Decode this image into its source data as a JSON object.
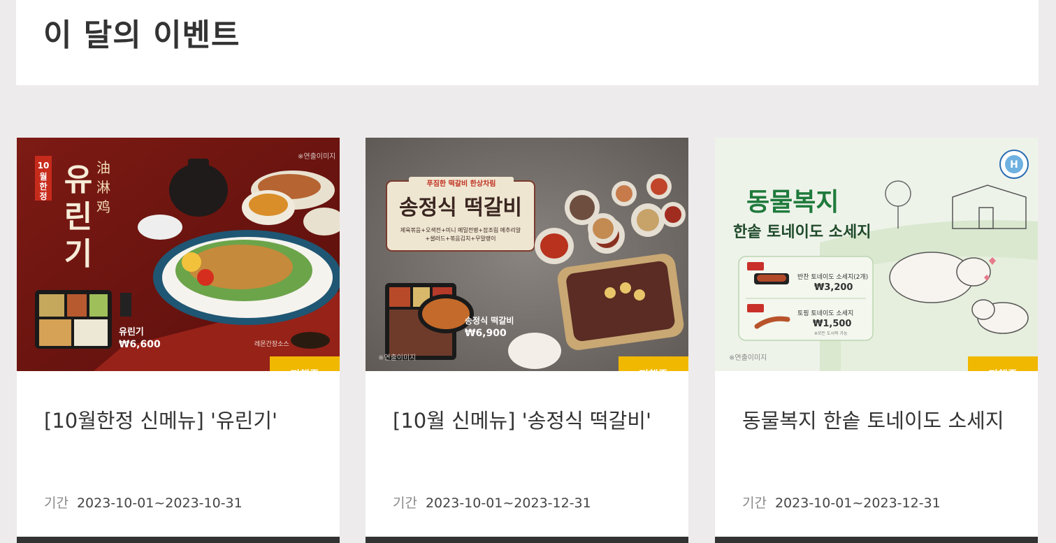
{
  "page": {
    "title": "이 달의 이벤트"
  },
  "cards": [
    {
      "title": "[10월한정 신메뉴] '유린기'",
      "period_label": "기간",
      "period": "2023-10-01~2023-10-31",
      "badge": "진행중",
      "image": {
        "vertical_label": "10월한정",
        "big_text": "유린기",
        "hanzi": "油淋鸡",
        "watermark": "※연출이미지",
        "product_name": "유린기",
        "price": "₩6,600",
        "sauce_label": "레몬간장소스"
      }
    },
    {
      "title": "[10월 신메뉴] '송정식 떡갈비'",
      "period_label": "기간",
      "period": "2023-10-01~2023-12-31",
      "badge": "진행중",
      "image": {
        "ribbon": "푸짐한 떡갈비 한상차림",
        "big_text": "송정식 떡갈비",
        "menu_line1": "제육볶음+오색전+미니 메밀전병+잡조림 메추리알",
        "menu_line2": "+샐러드+볶음김치+무말랭이",
        "product_name": "송정식 떡갈비",
        "price": "₩6,900",
        "watermark": "※연출이미지"
      }
    },
    {
      "title": "동물복지 한솥 토네이도 소세지",
      "period_label": "기간",
      "period": "2023-10-01~2023-12-31",
      "badge": "진행중",
      "image": {
        "big_text": "동물복지",
        "sub_text": "한솥 토네이도 소세지",
        "item1_name": "반찬 토네이도 소세지(2개)",
        "item1_price": "₩3,200",
        "item2_name": "토핑 토네이도 소세지",
        "item2_price": "₩1,500",
        "item2_note": "※모든 도시락 가능",
        "watermark": "※연출이미지"
      }
    }
  ],
  "colors": {
    "badge": "#f0b800",
    "background": "#edebeb",
    "card_border": "#333333"
  }
}
